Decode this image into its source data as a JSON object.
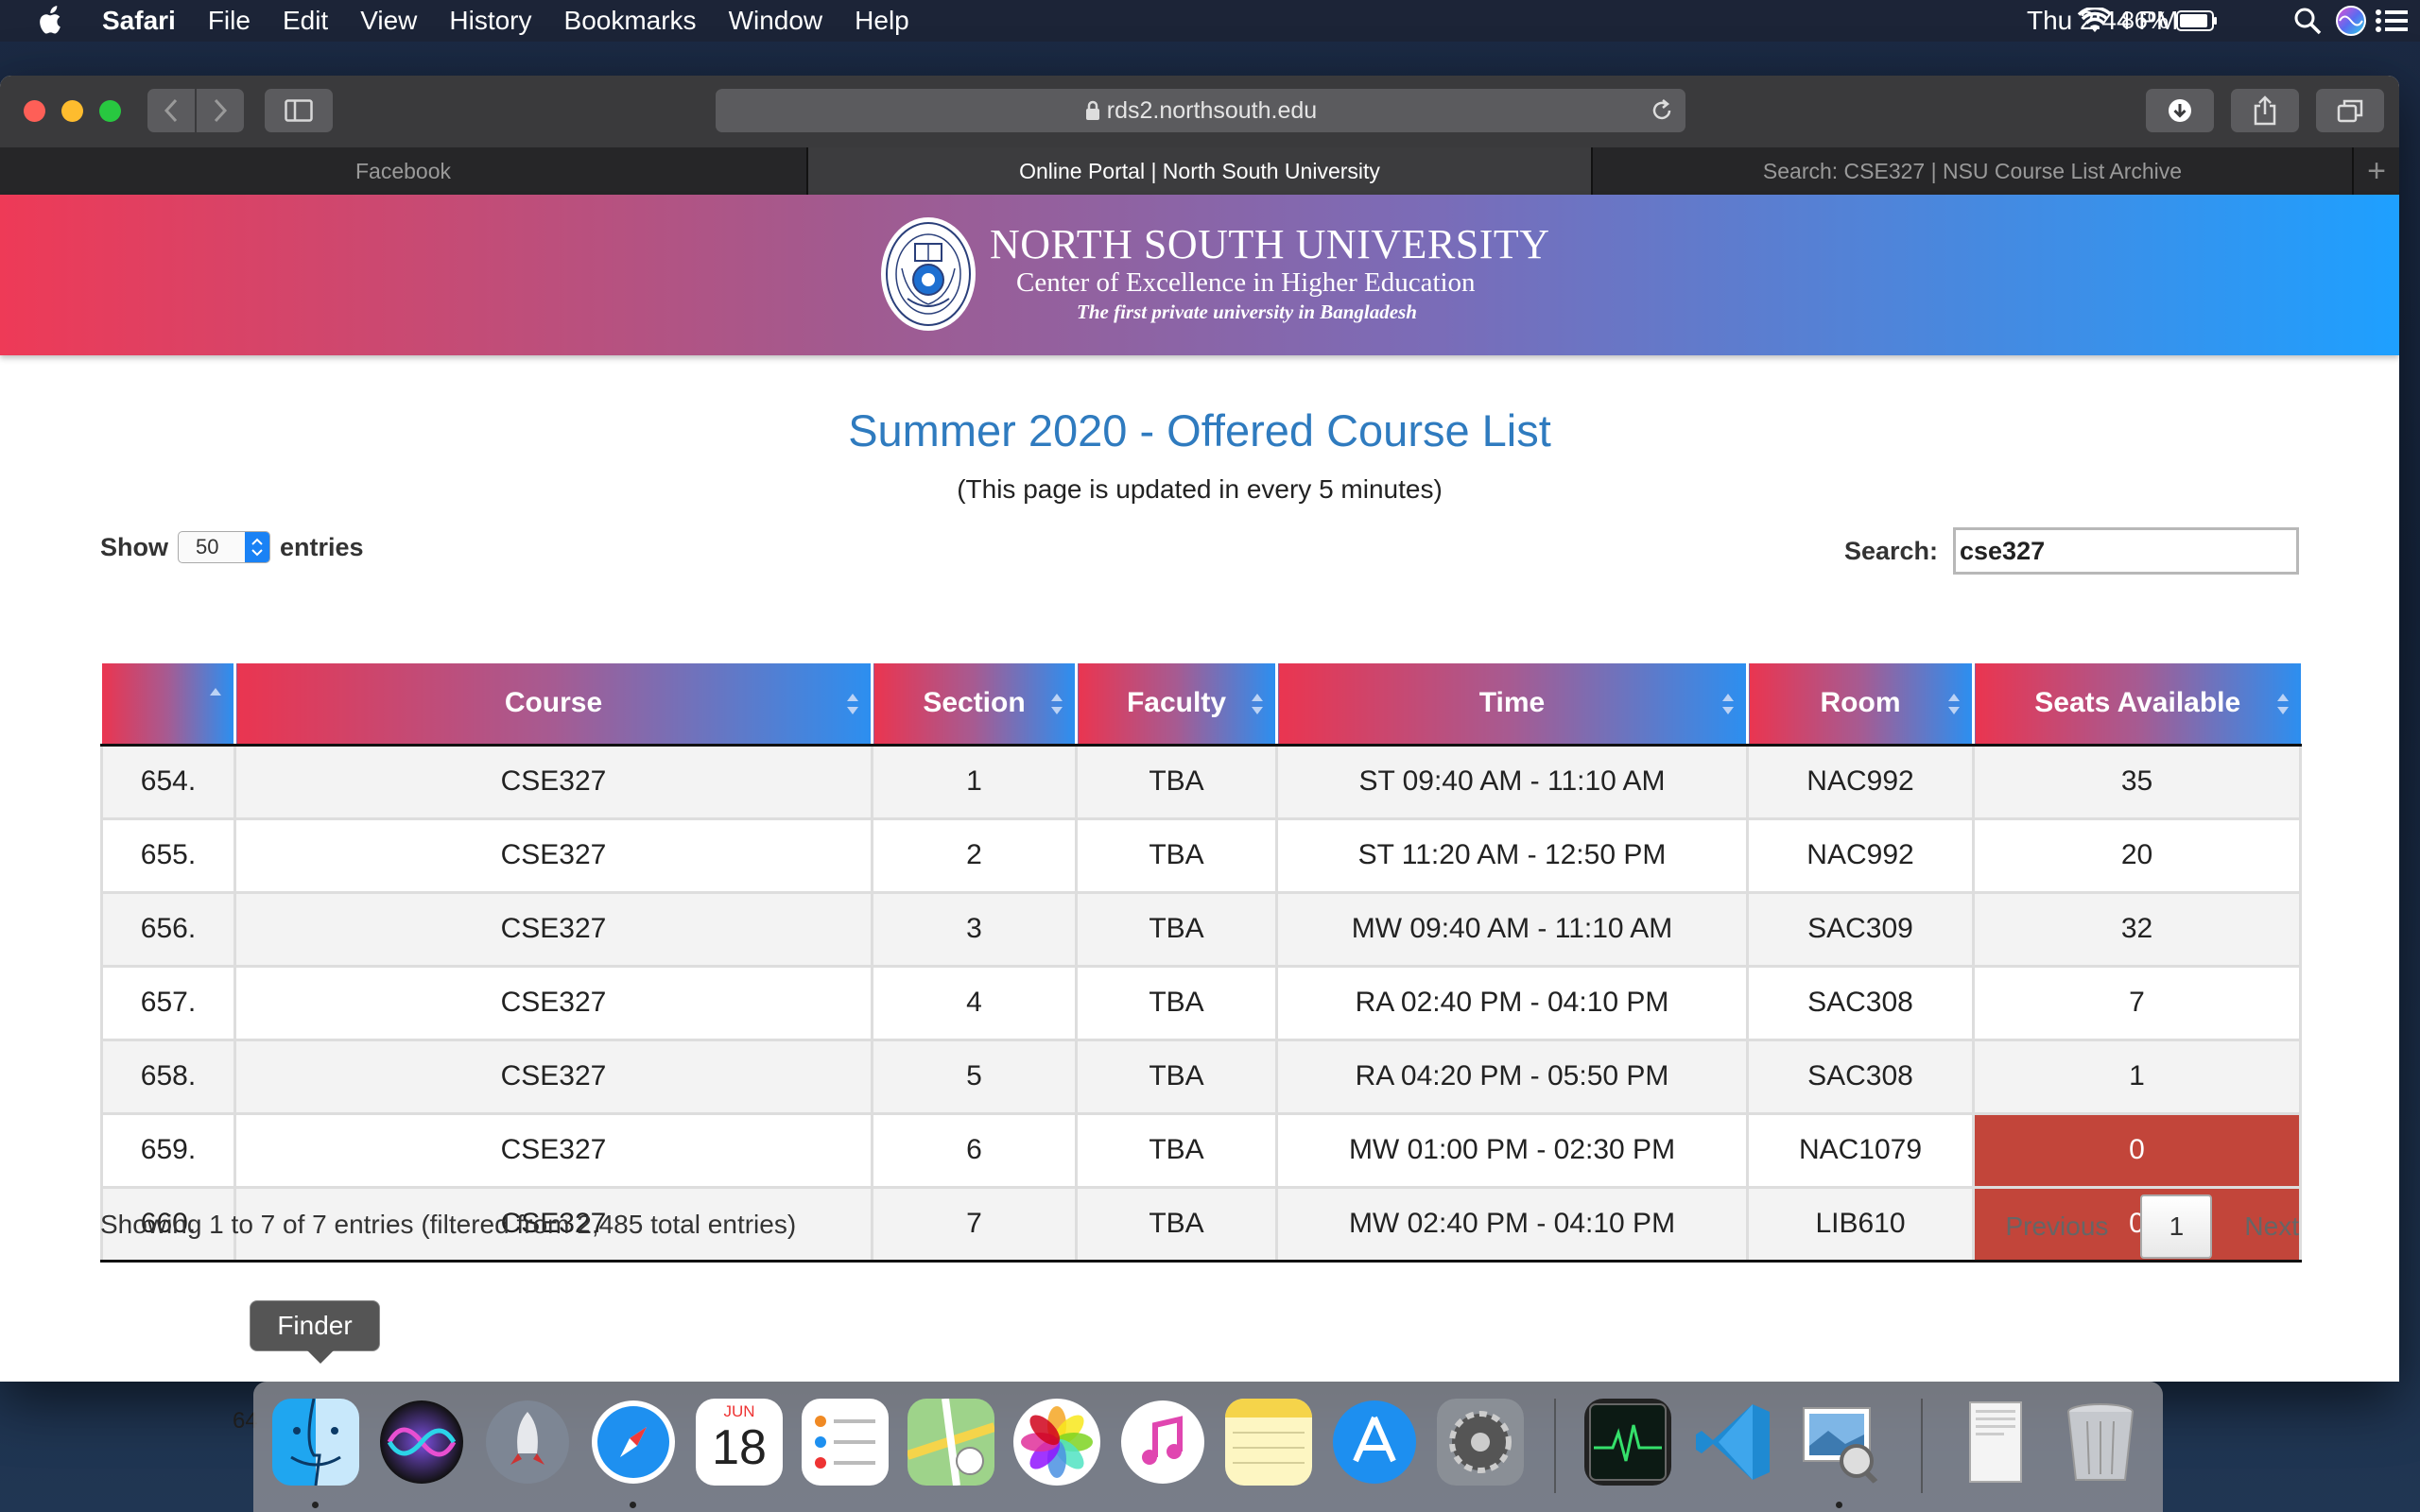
{
  "menubar": {
    "app": "Safari",
    "items": [
      "File",
      "Edit",
      "View",
      "History",
      "Bookmarks",
      "Window",
      "Help"
    ],
    "battery": "86%",
    "clock": "Thu 2:44 PM"
  },
  "browser": {
    "url": "rds2.northsouth.edu",
    "tabs": [
      {
        "label": "Facebook",
        "active": false
      },
      {
        "label": "Online Portal | North South University",
        "active": true
      },
      {
        "label": "Search: CSE327 | NSU Course List Archive",
        "active": false
      }
    ]
  },
  "banner": {
    "line1": "NORTH SOUTH UNIVERSITY",
    "line2": "Center of Excellence in Higher Education",
    "line3": "The first private university in Bangladesh",
    "seal_text": "SEEK KNOWLEDGE · NORTH SOUTH UNIVERSITY"
  },
  "page": {
    "title": "Summer 2020 - Offered Course List",
    "subtitle": "(This page is updated in every 5 minutes)"
  },
  "controls": {
    "show_label": "Show",
    "entries_value": "50",
    "entries_label": "entries",
    "search_label": "Search:",
    "search_value": "cse327"
  },
  "table": {
    "headers": [
      "",
      "Course",
      "Section",
      "Faculty",
      "Time",
      "Room",
      "Seats Available"
    ],
    "rows": [
      {
        "no": "654.",
        "course": "CSE327",
        "section": "1",
        "faculty": "TBA",
        "time": "ST 09:40 AM - 11:10 AM",
        "room": "NAC992",
        "seats": "35",
        "full": false
      },
      {
        "no": "655.",
        "course": "CSE327",
        "section": "2",
        "faculty": "TBA",
        "time": "ST 11:20 AM - 12:50 PM",
        "room": "NAC992",
        "seats": "20",
        "full": false
      },
      {
        "no": "656.",
        "course": "CSE327",
        "section": "3",
        "faculty": "TBA",
        "time": "MW 09:40 AM - 11:10 AM",
        "room": "SAC309",
        "seats": "32",
        "full": false
      },
      {
        "no": "657.",
        "course": "CSE327",
        "section": "4",
        "faculty": "TBA",
        "time": "RA 02:40 PM - 04:10 PM",
        "room": "SAC308",
        "seats": "7",
        "full": false
      },
      {
        "no": "658.",
        "course": "CSE327",
        "section": "5",
        "faculty": "TBA",
        "time": "RA 04:20 PM - 05:50 PM",
        "room": "SAC308",
        "seats": "1",
        "full": false
      },
      {
        "no": "659.",
        "course": "CSE327",
        "section": "6",
        "faculty": "TBA",
        "time": "MW 01:00 PM - 02:30 PM",
        "room": "NAC1079",
        "seats": "0",
        "full": true
      },
      {
        "no": "660.",
        "course": "CSE327",
        "section": "7",
        "faculty": "TBA",
        "time": "MW 02:40 PM - 04:10 PM",
        "room": "LIB610",
        "seats": "0",
        "full": true
      }
    ]
  },
  "footer": {
    "info": "Showing 1 to 7 of 7 entries (filtered from 2,485 total entries)",
    "previous": "Previous",
    "page": "1",
    "next": "Next"
  },
  "dock": {
    "tooltip": "Finder",
    "calendar_month": "JUN",
    "calendar_day": "18",
    "apps": [
      "finder-icon",
      "siri-icon",
      "launchpad-icon",
      "safari-icon",
      "calendar-icon",
      "reminders-icon",
      "maps-icon",
      "photos-icon",
      "itunes-icon",
      "notes-icon",
      "app-store-icon",
      "system-preferences-icon",
      "activity-monitor-icon",
      "vscode-icon",
      "preview-icon",
      "documents-stack-icon",
      "trash-icon"
    ]
  },
  "colors": {
    "banner_start": "#ee3a57",
    "banner_end": "#1ea0ff",
    "title_blue": "#2f7bbf",
    "full_red": "#c2453a"
  }
}
